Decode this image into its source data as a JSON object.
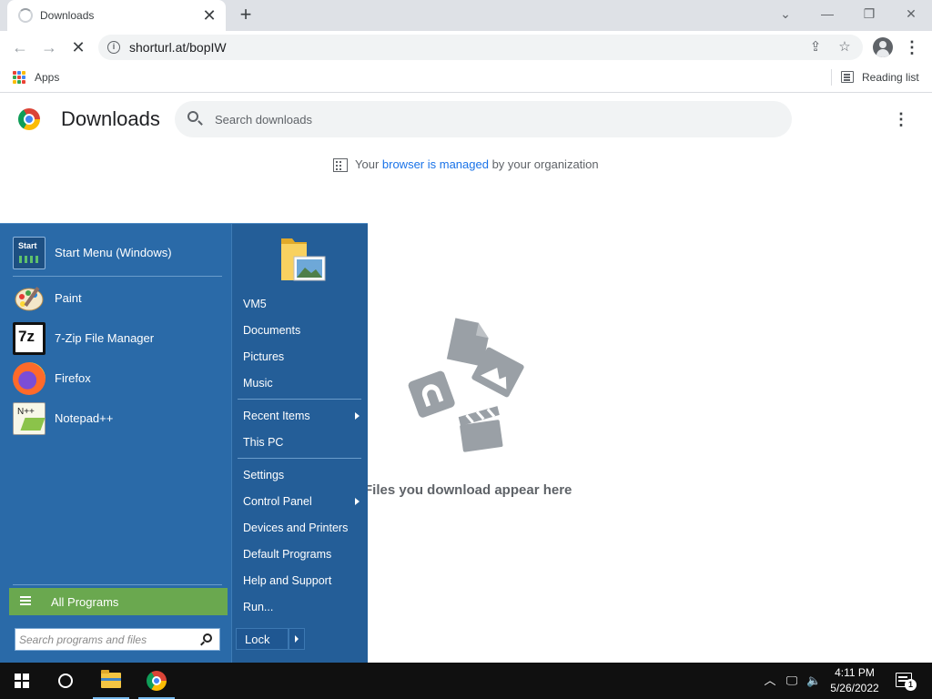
{
  "tab": {
    "title": "Downloads",
    "close_label": "✕",
    "new_tab_label": "+"
  },
  "toolbar": {
    "url": "shorturl.at/bopIW"
  },
  "bookmarks": {
    "apps_label": "Apps",
    "reading_list_label": "Reading list"
  },
  "page": {
    "title": "Downloads",
    "search_placeholder": "Search downloads",
    "managed_prefix": "Your ",
    "managed_link": "browser is managed",
    "managed_suffix": " by your organization",
    "empty_message": "Files you download appear here"
  },
  "start_menu": {
    "pinned": [
      {
        "label": "Start Menu (Windows)",
        "icon": "start-menu-icon"
      },
      {
        "label": "Paint",
        "icon": "paint-icon"
      },
      {
        "label": "7-Zip File Manager",
        "icon": "7zip-icon"
      },
      {
        "label": "Firefox",
        "icon": "firefox-icon"
      },
      {
        "label": "Notepad++",
        "icon": "notepadpp-icon"
      }
    ],
    "all_programs_label": "All Programs",
    "search_placeholder": "Search programs and files",
    "right_links": [
      {
        "label": "VM5",
        "submenu": false
      },
      {
        "label": "Documents",
        "submenu": false
      },
      {
        "label": "Pictures",
        "submenu": false
      },
      {
        "label": "Music",
        "submenu": false
      },
      {
        "label": "Recent Items",
        "submenu": true
      },
      {
        "label": "This PC",
        "submenu": false
      },
      {
        "label": "Settings",
        "submenu": false
      },
      {
        "label": "Control Panel",
        "submenu": true
      },
      {
        "label": "Devices and Printers",
        "submenu": false
      },
      {
        "label": "Default Programs",
        "submenu": false
      },
      {
        "label": "Help and Support",
        "submenu": false
      },
      {
        "label": "Run...",
        "submenu": false
      }
    ],
    "lock_label": "Lock",
    "start_tile_text": "Start"
  },
  "taskbar": {
    "time": "4:11 PM",
    "date": "5/26/2022",
    "notification_count": "1"
  },
  "colors": {
    "start_menu_bg": "#2a6aa8",
    "all_programs_bg": "#6aa84f",
    "link_blue": "#1a73e8"
  }
}
